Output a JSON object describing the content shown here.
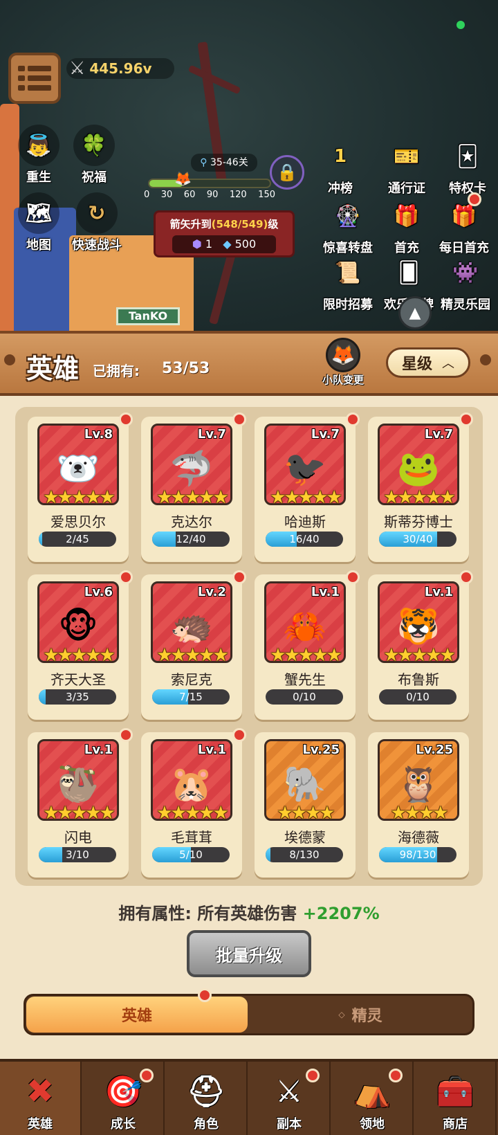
{
  "hud": {
    "power_value": "445.96v",
    "stage_range": "35-46关",
    "progress_ticks": [
      "0",
      "30",
      "60",
      "90",
      "120",
      "150"
    ],
    "left_buttons": [
      {
        "label": "重生",
        "icon": "angel-icon"
      },
      {
        "label": "祝福",
        "icon": "blessing-icon"
      },
      {
        "label": "地图",
        "icon": "map-icon"
      },
      {
        "label": "快速战斗",
        "icon": "fast-battle-icon"
      }
    ],
    "right_buttons": [
      {
        "label": "冲榜",
        "icon": "rank-icon"
      },
      {
        "label": "通行证",
        "icon": "pass-icon"
      },
      {
        "label": "特权卡",
        "icon": "privilege-card-icon"
      },
      {
        "label": "惊喜转盘",
        "icon": "wheel-icon"
      },
      {
        "label": "首充",
        "icon": "gift-icon"
      },
      {
        "label": "每日首充",
        "icon": "daily-gift-icon"
      },
      {
        "label": "限时招募",
        "icon": "recruit-icon"
      },
      {
        "label": "欢乐翻牌",
        "icon": "card-flip-icon"
      },
      {
        "label": "精灵乐园",
        "icon": "spirit-park-icon"
      }
    ],
    "rank_badge": "1",
    "upgrade_box": {
      "prefix": "箭矢升到",
      "progress": "(548/549)",
      "suffix": "级",
      "cost_a": "1",
      "cost_b": "500"
    },
    "sign_text": "TanKO"
  },
  "header": {
    "title": "英雄",
    "owned_label": "已拥有:",
    "owned_value": "53/53",
    "team_change": "小队变更",
    "sort_label": "星级"
  },
  "heroes": [
    {
      "name": "爱思贝尔",
      "level": "Lv.8",
      "stars": 5,
      "progress": "2/45",
      "fraction": 0.044,
      "bg": "red",
      "face": "🐻‍❄️"
    },
    {
      "name": "克达尔",
      "level": "Lv.7",
      "stars": 5,
      "progress": "12/40",
      "fraction": 0.3,
      "bg": "red",
      "face": "🦈"
    },
    {
      "name": "哈迪斯",
      "level": "Lv.7",
      "stars": 5,
      "progress": "16/40",
      "fraction": 0.4,
      "bg": "red",
      "face": "🐦‍⬛"
    },
    {
      "name": "斯蒂芬博士",
      "level": "Lv.7",
      "stars": 5,
      "progress": "30/40",
      "fraction": 0.75,
      "bg": "red",
      "face": "🐸"
    },
    {
      "name": "齐天大圣",
      "level": "Lv.6",
      "stars": 5,
      "progress": "3/35",
      "fraction": 0.086,
      "bg": "red",
      "face": "🐵"
    },
    {
      "name": "索尼克",
      "level": "Lv.2",
      "stars": 5,
      "progress": "7/15",
      "fraction": 0.467,
      "bg": "red",
      "face": "🦔"
    },
    {
      "name": "蟹先生",
      "level": "Lv.1",
      "stars": 5,
      "progress": "0/10",
      "fraction": 0,
      "bg": "red",
      "face": "🦀"
    },
    {
      "name": "布鲁斯",
      "level": "Lv.1",
      "stars": 5,
      "progress": "0/10",
      "fraction": 0,
      "bg": "red",
      "face": "🐯"
    },
    {
      "name": "闪电",
      "level": "Lv.1",
      "stars": 5,
      "progress": "3/10",
      "fraction": 0.3,
      "bg": "red",
      "face": "🦥"
    },
    {
      "name": "毛茸茸",
      "level": "Lv.1",
      "stars": 5,
      "progress": "5/10",
      "fraction": 0.5,
      "bg": "red",
      "face": "🐹"
    },
    {
      "name": "埃德蒙",
      "level": "Lv.25",
      "stars": 4,
      "progress": "8/130",
      "fraction": 0.062,
      "bg": "orange",
      "face": "🐘"
    },
    {
      "name": "海德薇",
      "level": "Lv.25",
      "stars": 4,
      "progress": "98/130",
      "fraction": 0.754,
      "bg": "orange",
      "face": "🦉"
    }
  ],
  "bonus": {
    "label": "拥有属性: 所有英雄伤害",
    "value": "+2207%"
  },
  "batch_upgrade": "批量升级",
  "tabs": {
    "heroes": "英雄",
    "spirits": "精灵"
  },
  "nav": [
    {
      "label": "英雄",
      "icon": "close-x-icon",
      "active": true,
      "dot": false
    },
    {
      "label": "成长",
      "icon": "growth-icon",
      "active": false,
      "dot": true
    },
    {
      "label": "角色",
      "icon": "knight-helmet-icon",
      "active": false,
      "dot": false
    },
    {
      "label": "副本",
      "icon": "crossed-swords-icon",
      "active": false,
      "dot": true
    },
    {
      "label": "领地",
      "icon": "territory-tent-icon",
      "active": false,
      "dot": true
    },
    {
      "label": "商店",
      "icon": "treasure-chest-icon",
      "active": false,
      "dot": false
    }
  ],
  "colors": {
    "accent_orange": "#f5a24a",
    "bonus_green": "#2f9e2f",
    "red_dot": "#e03a2f"
  }
}
